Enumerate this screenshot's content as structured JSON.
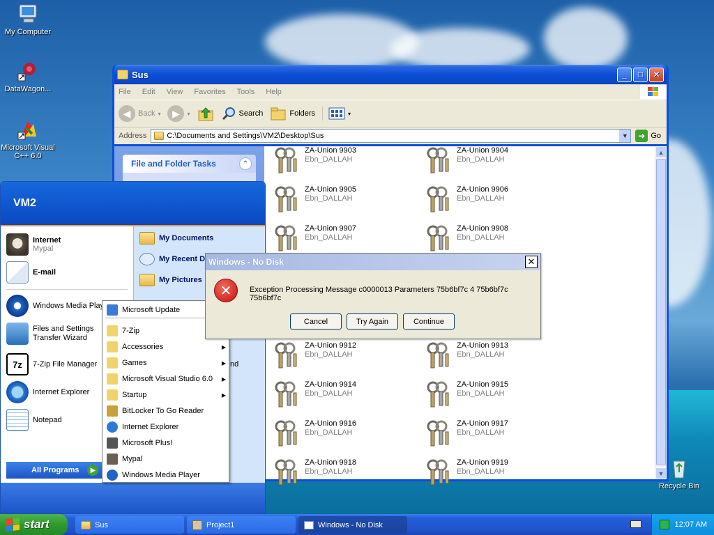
{
  "desktop": {
    "icons": [
      {
        "label": "My Computer"
      },
      {
        "label": "DataWagon..."
      },
      {
        "label": "Microsoft Visual C++ 6.0"
      },
      {
        "label": "Recycle Bin"
      }
    ]
  },
  "explorer": {
    "title": "Sus",
    "menu": [
      "File",
      "Edit",
      "View",
      "Favorites",
      "Tools",
      "Help"
    ],
    "toolbar": {
      "back": "Back",
      "search": "Search",
      "folders": "Folders"
    },
    "address_label": "Address",
    "address_value": "C:\\Documents and Settings\\VM2\\Desktop\\Sus",
    "go_label": "Go",
    "tasks_header": "File and Folder Tasks",
    "files": [
      {
        "name": "ZA-Union 9903",
        "sub": "Ebn_DALLAH"
      },
      {
        "name": "ZA-Union 9904",
        "sub": "Ebn_DALLAH"
      },
      {
        "name": "ZA-Union 9905",
        "sub": "Ebn_DALLAH"
      },
      {
        "name": "ZA-Union 9906",
        "sub": "Ebn_DALLAH"
      },
      {
        "name": "ZA-Union 9907",
        "sub": "Ebn_DALLAH"
      },
      {
        "name": "ZA-Union 9908",
        "sub": "Ebn_DALLAH"
      },
      {
        "name": "ZA-Union 9912",
        "sub": "Ebn_DALLAH"
      },
      {
        "name": "ZA-Union 9913",
        "sub": "Ebn_DALLAH"
      },
      {
        "name": "ZA-Union 9914",
        "sub": "Ebn_DALLAH"
      },
      {
        "name": "ZA-Union 9915",
        "sub": "Ebn_DALLAH"
      },
      {
        "name": "ZA-Union 9916",
        "sub": "Ebn_DALLAH"
      },
      {
        "name": "ZA-Union 9917",
        "sub": "Ebn_DALLAH"
      },
      {
        "name": "ZA-Union 9918",
        "sub": "Ebn_DALLAH"
      },
      {
        "name": "ZA-Union 9919",
        "sub": "Ebn_DALLAH"
      }
    ]
  },
  "startmenu": {
    "user": "VM2",
    "pinned": [
      {
        "label": "Internet",
        "sub": "Mypal"
      },
      {
        "label": "E-mail",
        "sub": ""
      }
    ],
    "recent": [
      "Windows Media Player",
      "Files and Settings Transfer Wizard",
      "7-Zip File Manager",
      "Internet Explorer",
      "Notepad"
    ],
    "right": [
      "My Documents",
      "My Recent Documents",
      "My Pictures"
    ],
    "right_partial": "nd",
    "all_programs": "All Programs"
  },
  "programs": [
    {
      "label": "Microsoft Update",
      "arrow": false
    },
    {
      "label": "7-Zip",
      "arrow": false
    },
    {
      "label": "Accessories",
      "arrow": true
    },
    {
      "label": "Games",
      "arrow": true
    },
    {
      "label": "Microsoft Visual Studio 6.0",
      "arrow": true
    },
    {
      "label": "Startup",
      "arrow": true
    },
    {
      "label": "BitLocker To Go Reader",
      "arrow": false
    },
    {
      "label": "Internet Explorer",
      "arrow": false
    },
    {
      "label": "Microsoft Plus!",
      "arrow": false
    },
    {
      "label": "Mypal",
      "arrow": false
    },
    {
      "label": "Windows Media Player",
      "arrow": false
    }
  ],
  "dialog": {
    "title": "Windows - No Disk",
    "message": "Exception Processing Message c0000013 Parameters 75b6bf7c 4 75b6bf7c 75b6bf7c",
    "buttons": [
      "Cancel",
      "Try Again",
      "Continue"
    ]
  },
  "taskbar": {
    "start": "start",
    "tasks": [
      {
        "label": "Sus"
      },
      {
        "label": "Project1"
      },
      {
        "label": "Windows - No Disk"
      }
    ],
    "clock": "12:07 AM"
  },
  "colors": {
    "xp_blue": "#0a4fd8",
    "start_green": "#2f9a2f",
    "error_red": "#c41111"
  }
}
